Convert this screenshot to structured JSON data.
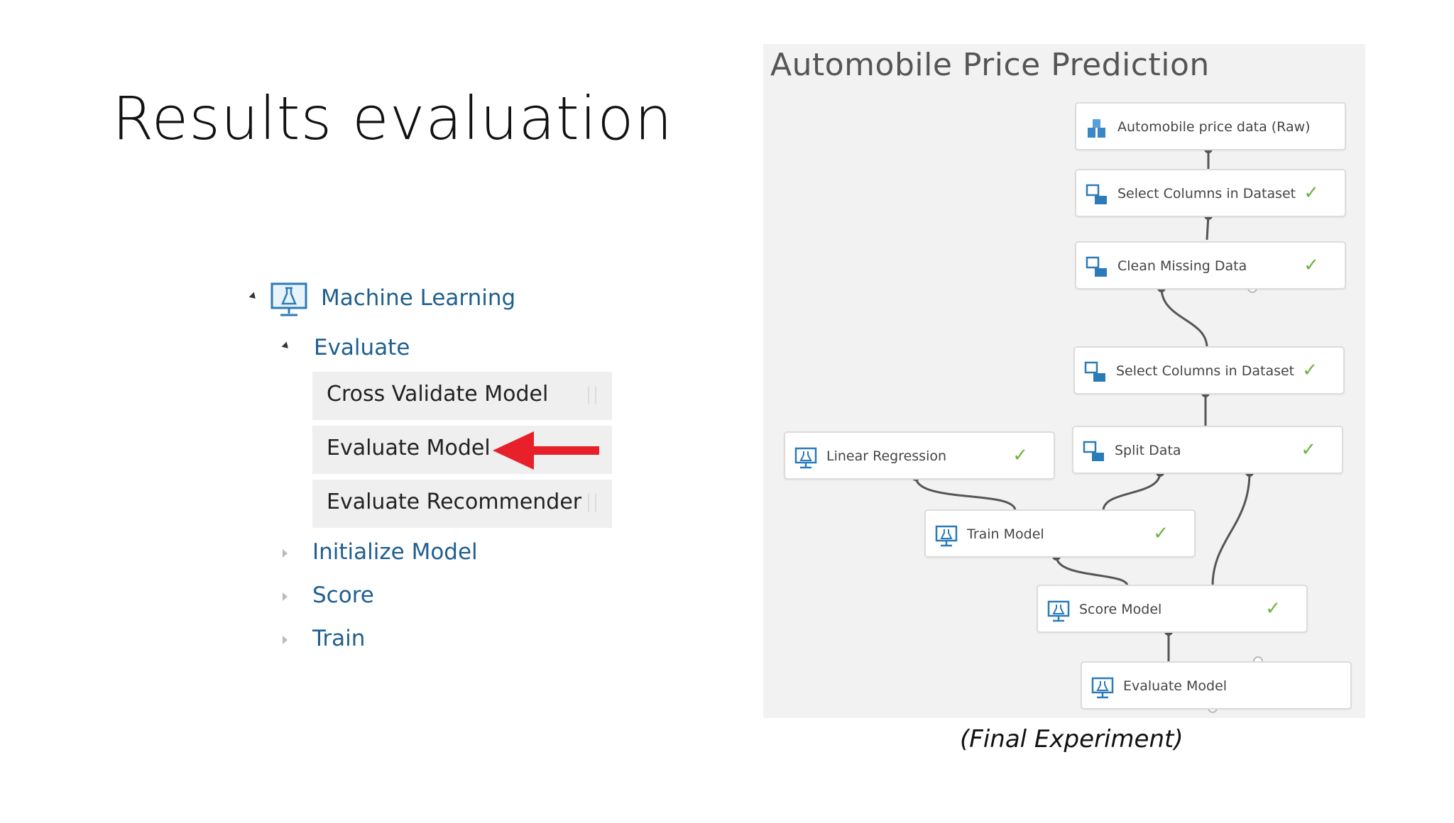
{
  "slide": {
    "title": "Results evaluation"
  },
  "palette": {
    "root": "Machine Learning",
    "evaluate": "Evaluate",
    "modules": [
      {
        "label": "Cross Validate Model"
      },
      {
        "label": "Evaluate Model"
      },
      {
        "label": "Evaluate Recommender"
      }
    ],
    "collapsed": [
      {
        "label": "Initialize Model"
      },
      {
        "label": "Score"
      },
      {
        "label": "Train"
      }
    ]
  },
  "experiment": {
    "title": "Automobile Price Prediction",
    "caption": "(Final Experiment)",
    "check_color": "#6cb33e",
    "nodes": [
      {
        "label": "Automobile price data (Raw)",
        "icon": "dataset-icon",
        "done": false
      },
      {
        "label": "Select Columns in Dataset",
        "icon": "transform-icon",
        "done": true
      },
      {
        "label": "Clean Missing Data",
        "icon": "transform-icon",
        "done": true
      },
      {
        "label": "Select Columns in Dataset",
        "icon": "transform-icon",
        "done": true
      },
      {
        "label": "Split Data",
        "icon": "transform-icon",
        "done": true
      },
      {
        "label": "Linear Regression",
        "icon": "ml-module-icon",
        "done": true
      },
      {
        "label": "Train Model",
        "icon": "ml-module-icon",
        "done": true
      },
      {
        "label": "Score Model",
        "icon": "ml-module-icon",
        "done": true
      },
      {
        "label": "Evaluate Model",
        "icon": "ml-module-icon",
        "done": false
      }
    ]
  },
  "annotation": {
    "arrow_color": "#e8202a",
    "target": "Evaluate Model"
  }
}
